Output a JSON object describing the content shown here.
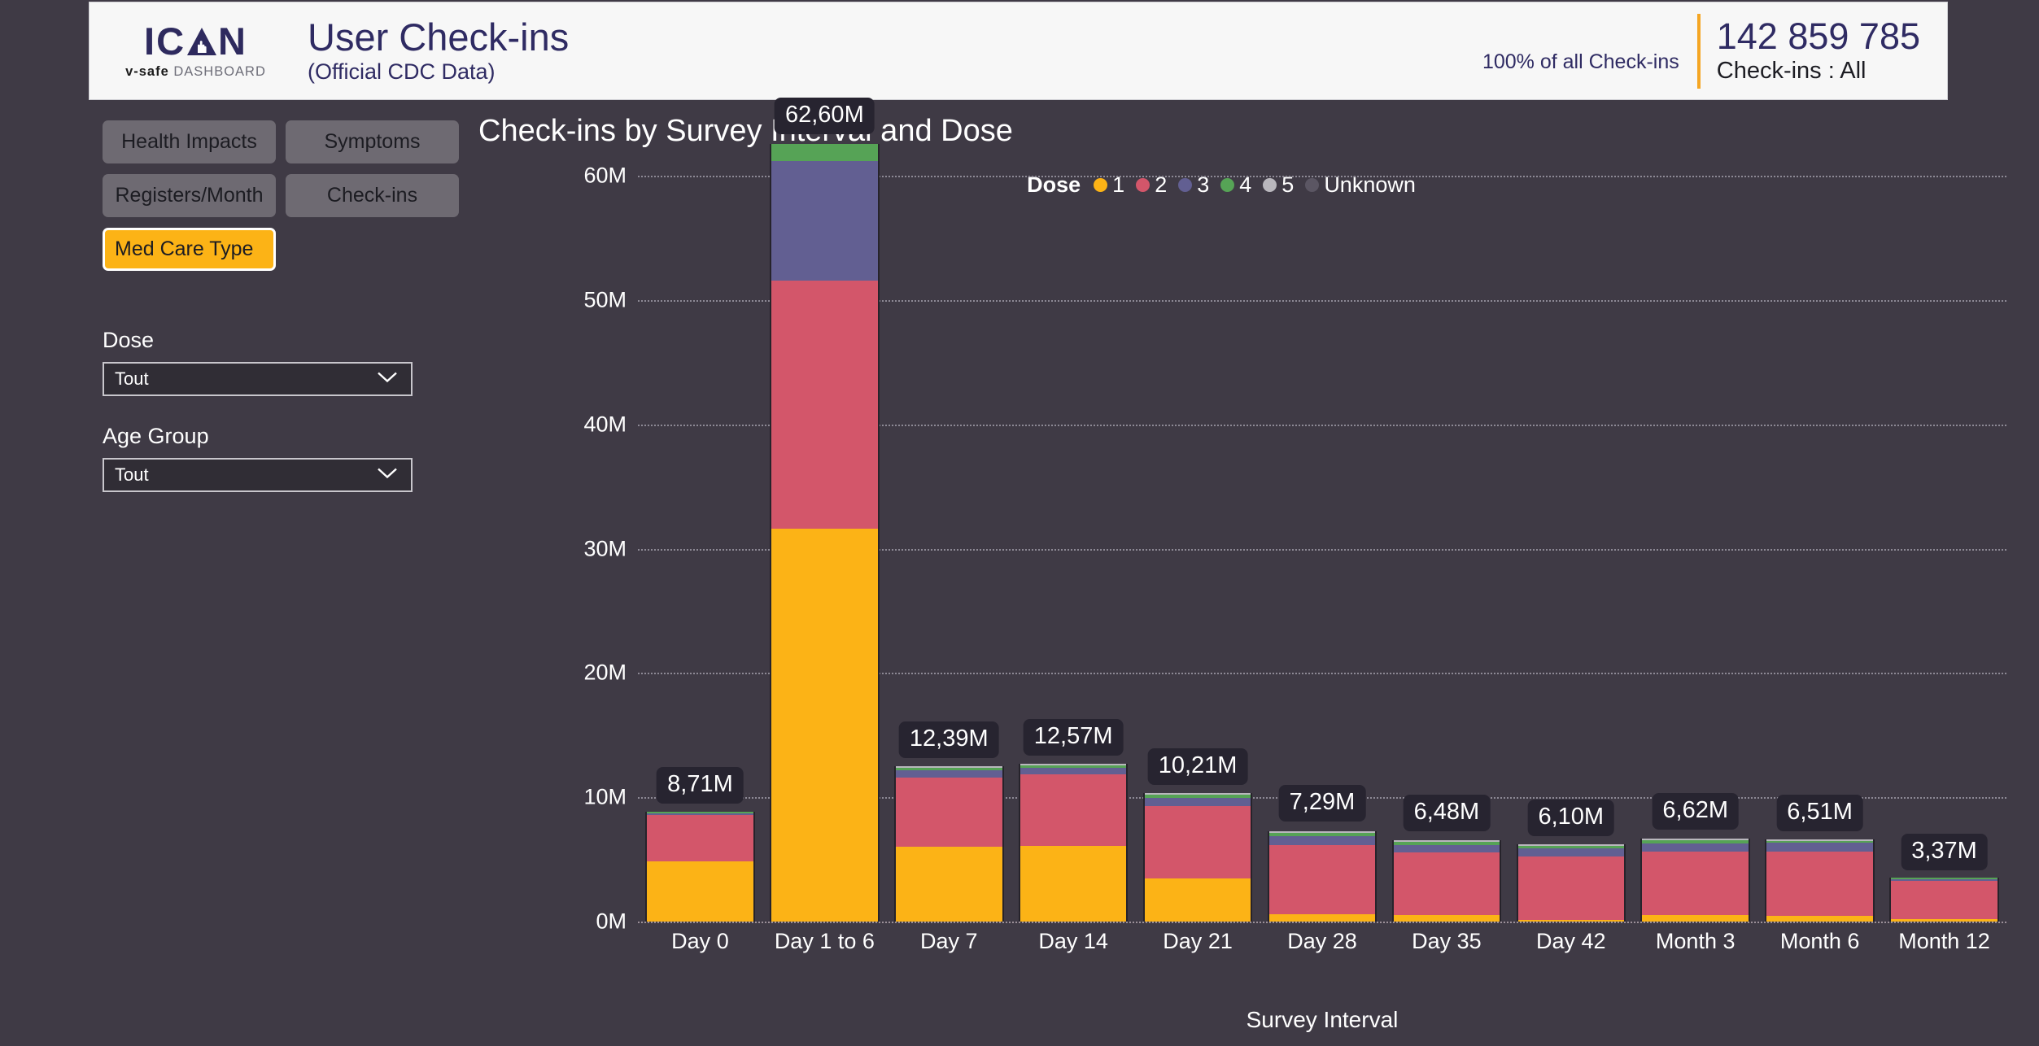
{
  "header": {
    "logo_wordmark": "ICAN",
    "logo_sub_bold": "v-safe",
    "logo_sub_rest": "DASHBOARD",
    "title": "User Check-ins",
    "subtitle": "(Official CDC Data)",
    "percent_label": "100% of all Check-ins",
    "kpi_value": "142 859 785",
    "kpi_caption": "Check-ins : All",
    "divider_color": "#f5a623"
  },
  "sidebar": {
    "nav_buttons": [
      {
        "label": "Health Impacts",
        "active": false
      },
      {
        "label": "Symptoms",
        "active": false
      },
      {
        "label": "Registers/Month",
        "active": false
      },
      {
        "label": "Check-ins",
        "active": false
      },
      {
        "label": "Med Care Type",
        "active": true
      }
    ],
    "filters": [
      {
        "label": "Dose",
        "value": "Tout",
        "icon": "chevron-down-icon"
      },
      {
        "label": "Age Group",
        "value": "Tout",
        "icon": "chevron-down-icon"
      }
    ]
  },
  "chart_data": {
    "type": "bar",
    "stacked": true,
    "title": "Check-ins by Survey Interval and Dose",
    "xlabel": "Survey Interval",
    "ylabel": "",
    "ylim": [
      0,
      65
    ],
    "yticks": [
      0,
      10,
      20,
      30,
      40,
      50,
      60
    ],
    "ytick_labels": [
      "0M",
      "10M",
      "20M",
      "30M",
      "40M",
      "50M",
      "60M"
    ],
    "grid": true,
    "legend_title": "Dose",
    "legend_position": "top-center",
    "units": "millions",
    "categories": [
      "Day 0",
      "Day 1 to 6",
      "Day 7",
      "Day 14",
      "Day 21",
      "Day 28",
      "Day 35",
      "Day 42",
      "Month 3",
      "Month 6",
      "Month 12"
    ],
    "series": [
      {
        "name": "1",
        "color": "#fcb316",
        "values": [
          4.85,
          31.6,
          6.05,
          6.1,
          3.45,
          0.62,
          0.55,
          0.1,
          0.5,
          0.45,
          0.2
        ]
      },
      {
        "name": "2",
        "color": "#d3566a",
        "values": [
          3.72,
          20.0,
          5.55,
          5.75,
          5.85,
          5.55,
          5.0,
          5.1,
          5.15,
          5.2,
          3.1
        ]
      },
      {
        "name": "3",
        "color": "#625f92",
        "values": [
          0.12,
          9.6,
          0.58,
          0.5,
          0.65,
          0.72,
          0.62,
          0.65,
          0.66,
          0.68,
          0.06
        ]
      },
      {
        "name": "4",
        "color": "#56a356",
        "values": [
          0.02,
          1.4,
          0.19,
          0.2,
          0.24,
          0.26,
          0.25,
          0.22,
          0.26,
          0.16,
          0.01
        ]
      },
      {
        "name": "5",
        "color": "#b9b7bd",
        "values": [
          0.0,
          0.0,
          0.02,
          0.02,
          0.02,
          0.14,
          0.06,
          0.03,
          0.05,
          0.02,
          0.0
        ]
      },
      {
        "name": "Unknown",
        "color": "#5b5663",
        "values": [
          0.0,
          0.0,
          0.0,
          0.0,
          0.0,
          0.0,
          0.0,
          0.0,
          0.0,
          0.0,
          0.0
        ]
      }
    ],
    "totals": [
      8.71,
      62.6,
      12.39,
      12.57,
      10.21,
      7.29,
      6.48,
      6.1,
      6.62,
      6.51,
      3.37
    ],
    "total_labels": [
      "8,71M",
      "62,60M",
      "12,39M",
      "12,57M",
      "10,21M",
      "7,29M",
      "6,48M",
      "6,10M",
      "6,62M",
      "6,51M",
      "3,37M"
    ]
  }
}
